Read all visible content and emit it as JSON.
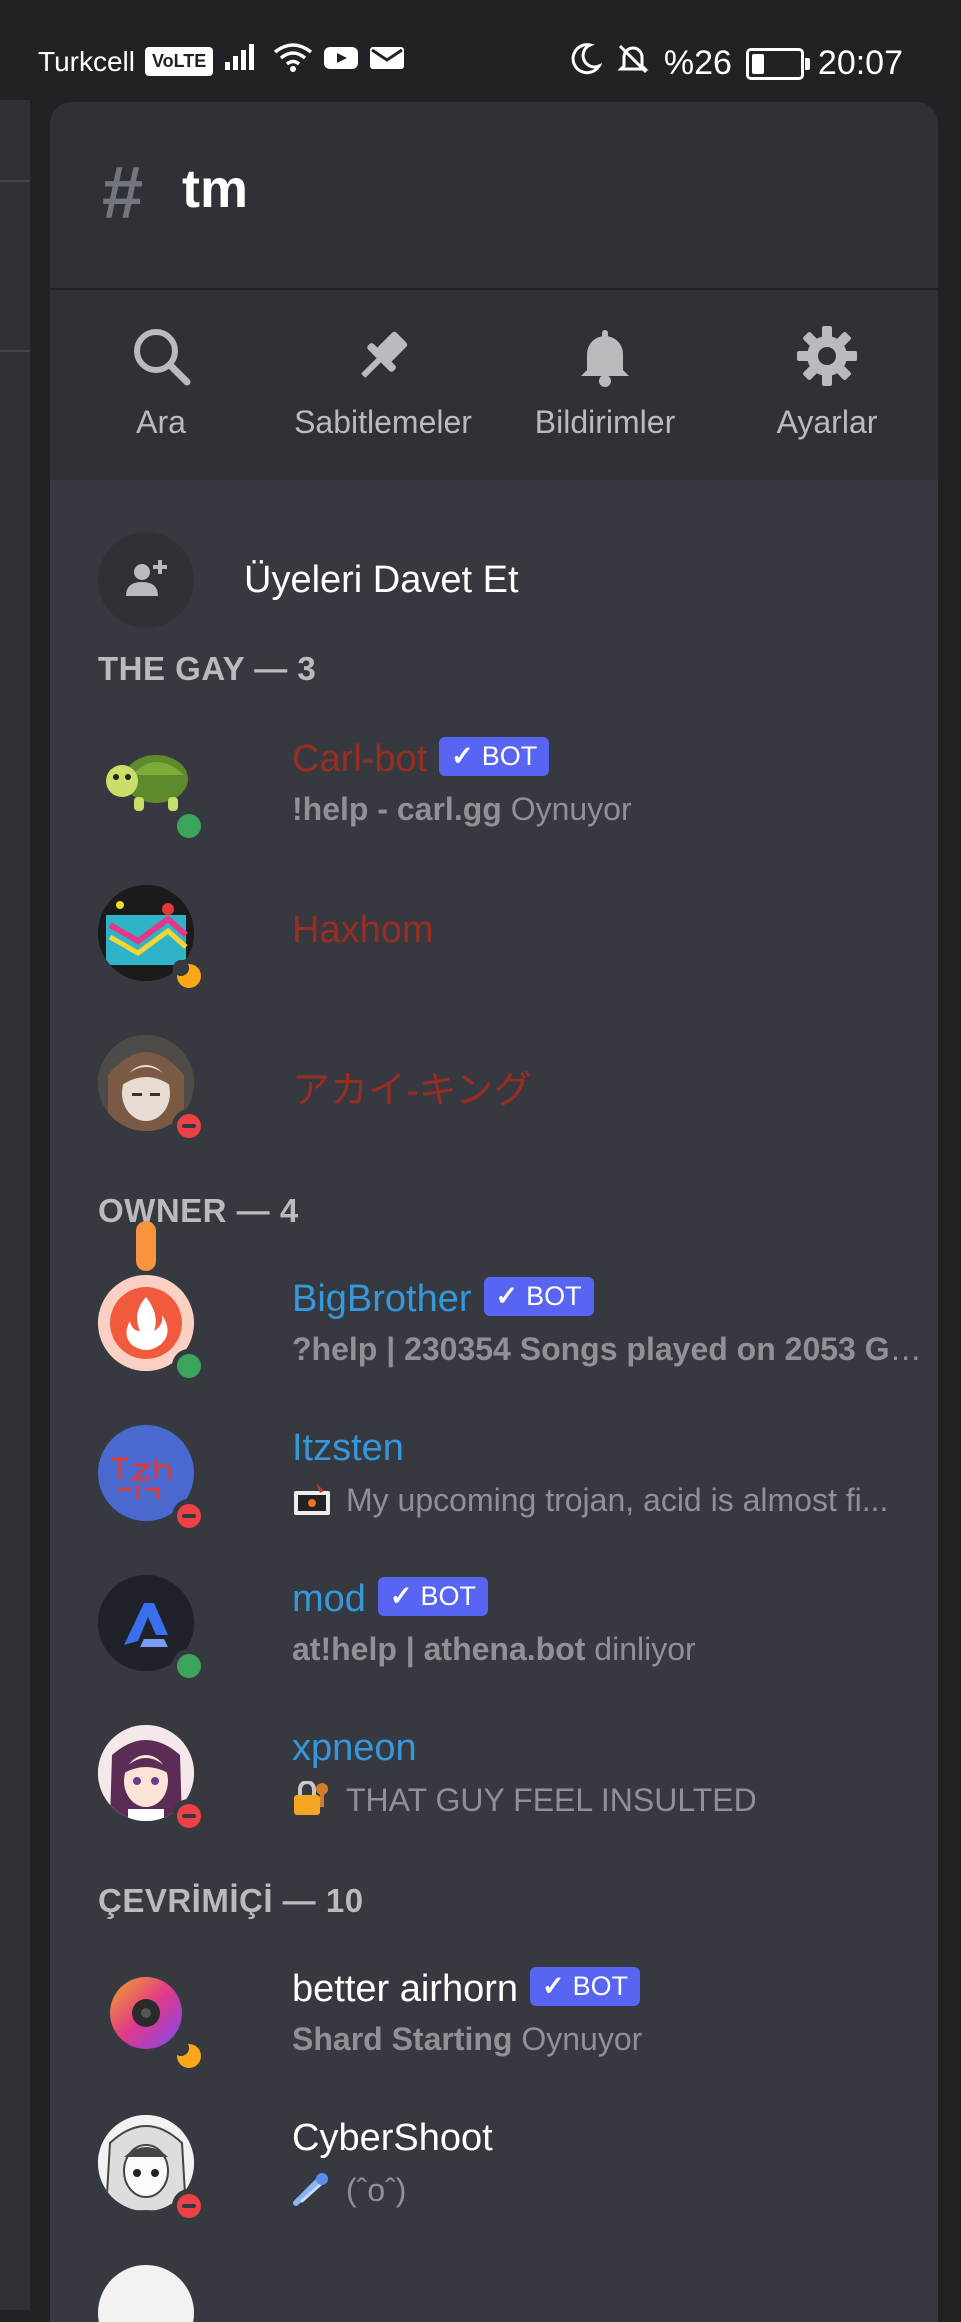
{
  "status_bar": {
    "carrier": "Turkcell",
    "volte": "VoLTE",
    "battery_text": "%26",
    "battery_level": 0.26,
    "time": "20:07"
  },
  "channel": {
    "hash": "#",
    "name": "tm"
  },
  "actions": [
    {
      "label": "Ara",
      "icon": "search-icon"
    },
    {
      "label": "Sabitlemeler",
      "icon": "pin-icon"
    },
    {
      "label": "Bildirimler",
      "icon": "bell-icon"
    },
    {
      "label": "Ayarlar",
      "icon": "gear-icon"
    }
  ],
  "invite_label": "Üyeleri Davet Et",
  "sections": {
    "gay": "THE GAY — 3",
    "owner": "OWNER — 4",
    "online": "ÇEVRİMİÇİ — 10"
  },
  "bot_tag": "BOT",
  "bot_check": "✓",
  "members": {
    "carl": {
      "name": "Carl-bot",
      "status_bold": "!help - carl.gg",
      "status_rest": " Oynuyor",
      "color": "#992d22",
      "presence": "online"
    },
    "haxhom": {
      "name": "Haxhom",
      "color": "#992d22",
      "presence": "idle"
    },
    "akai": {
      "name": "アカイ-キング",
      "color": "#992d22",
      "presence": "dnd"
    },
    "bigbrother": {
      "name": "BigBrother",
      "status_bold": "?help | 230354 Songs played on 2053 Gu...",
      "color": "#3498db",
      "presence": "online"
    },
    "itzsten": {
      "name": "Itzsten",
      "status": "My upcoming trojan, acid is almost fi...",
      "color": "#3498db",
      "presence": "dnd"
    },
    "mod": {
      "name": "mod",
      "status_bold": "at!help | athena.bot",
      "status_rest": " dinliyor",
      "color": "#3498db",
      "presence": "online"
    },
    "xpneon": {
      "name": "xpneon",
      "status": "THAT GUY FEEL INSULTED",
      "color": "#3498db",
      "presence": "dnd"
    },
    "airhorn": {
      "name": "better airhorn",
      "status_bold": "Shard Starting",
      "status_rest": " Oynuyor",
      "color": "#ffffff",
      "presence": "idle"
    },
    "cybershoot": {
      "name": "CyberShoot",
      "status": "(ˆoˆ)",
      "color": "#ffffff",
      "presence": "dnd"
    }
  }
}
